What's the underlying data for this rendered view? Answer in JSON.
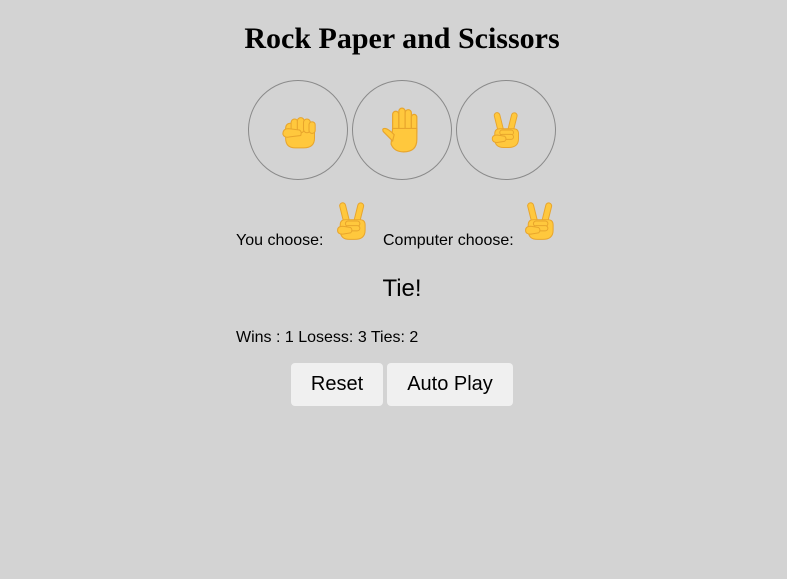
{
  "title": "Rock Paper and Scissors",
  "choices": [
    {
      "name": "rock",
      "icon": "fist-icon"
    },
    {
      "name": "paper",
      "icon": "raised-hand-icon"
    },
    {
      "name": "scissors",
      "icon": "victory-hand-icon"
    }
  ],
  "moves": {
    "player_label": "You choose:",
    "player_icon": "victory-hand-icon",
    "computer_label": "Computer choose:",
    "computer_icon": "victory-hand-icon"
  },
  "result": "Tie!",
  "score": "Wins : 1 Losess: 3 Ties: 2",
  "buttons": {
    "reset": "Reset",
    "auto_play": "Auto Play"
  },
  "colors": {
    "background": "#d3d3d3",
    "emoji_yellow": "#ffc83d",
    "emoji_shade": "#e8a52c",
    "button_bg": "#f0f0f0"
  }
}
